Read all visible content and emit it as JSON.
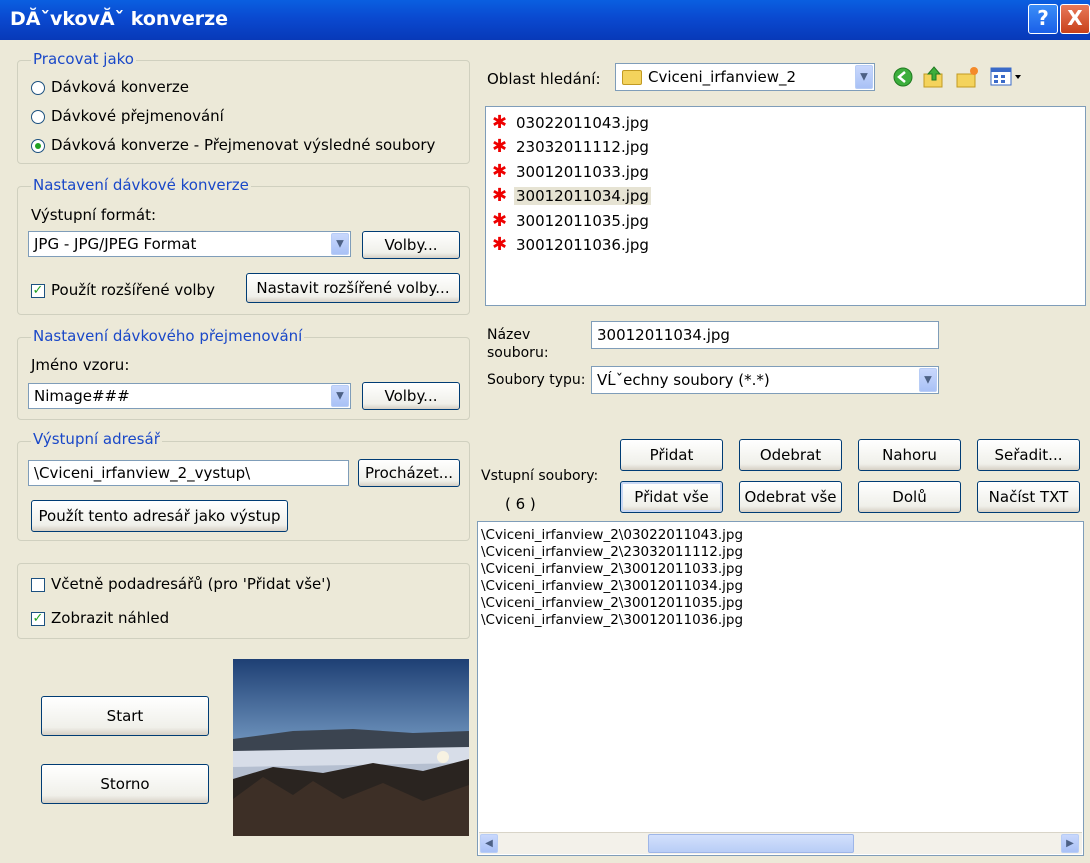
{
  "window": {
    "title": "DĂˇvkovĂˇ konverze",
    "help": "?",
    "close": "X"
  },
  "work_as": {
    "legend": "Pracovat jako",
    "options": [
      "Dávková konverze",
      "Dávkové přejmenování",
      "Dávková konverze - Přejmenovat výsledné soubory"
    ],
    "selected_index": 2
  },
  "conversion": {
    "legend": "Nastavení dávkové konverze",
    "format_label": "Výstupní formát:",
    "format_value": "JPG - JPG/JPEG Format",
    "options_button": "Volby...",
    "advanced_checkbox": "Použít rozšířené volby",
    "advanced_checked": true,
    "advanced_button": "Nastavit rozšířené volby..."
  },
  "rename": {
    "legend": "Nastavení dávkového přejmenování",
    "pattern_label": "Jméno vzoru:",
    "pattern_value": "Nimage###",
    "options_button": "Volby..."
  },
  "output": {
    "legend": "Výstupní adresář",
    "dir_value": "\\Cviceni_irfanview_2_vystup\\",
    "browse_button": "Procházet...",
    "use_current_button": "Použít tento adresář jako výstup"
  },
  "misc": {
    "subdirs_label": "Včetně podadresářů (pro 'Přidat vše')",
    "subdirs_checked": false,
    "preview_label": "Zobrazit náhled",
    "preview_checked": true
  },
  "actions": {
    "start": "Start",
    "cancel": "Storno"
  },
  "browser": {
    "look_in_label": "Oblast hledání:",
    "look_in_value": "Cviceni_irfanview_2",
    "files": [
      "03022011043.jpg",
      "23032011112.jpg",
      "30012011033.jpg",
      "30012011034.jpg",
      "30012011035.jpg",
      "30012011036.jpg"
    ],
    "selected_file_index": 3,
    "filename_label": "Název souboru:",
    "filename_value": "30012011034.jpg",
    "filetype_label": "Soubory typu:",
    "filetype_value": "VĹˇechny soubory (*.*)"
  },
  "input_files": {
    "label": "Vstupní soubory:",
    "count": "( 6 )",
    "buttons": {
      "add": "Přidat",
      "remove": "Odebrat",
      "up": "Nahoru",
      "sort": "Seřadit...",
      "add_all": "Přidat vše",
      "remove_all": "Odebrat vše",
      "down": "Dolů",
      "load_txt": "Načíst TXT"
    },
    "items": [
      "\\Cviceni_irfanview_2\\03022011043.jpg",
      "\\Cviceni_irfanview_2\\23032011112.jpg",
      "\\Cviceni_irfanview_2\\30012011033.jpg",
      "\\Cviceni_irfanview_2\\30012011034.jpg",
      "\\Cviceni_irfanview_2\\30012011035.jpg",
      "\\Cviceni_irfanview_2\\30012011036.jpg"
    ]
  },
  "colors": {
    "titlebar": "#0a49d0",
    "group_legend": "#1a48c8",
    "dialog_bg": "#ece9d8"
  }
}
